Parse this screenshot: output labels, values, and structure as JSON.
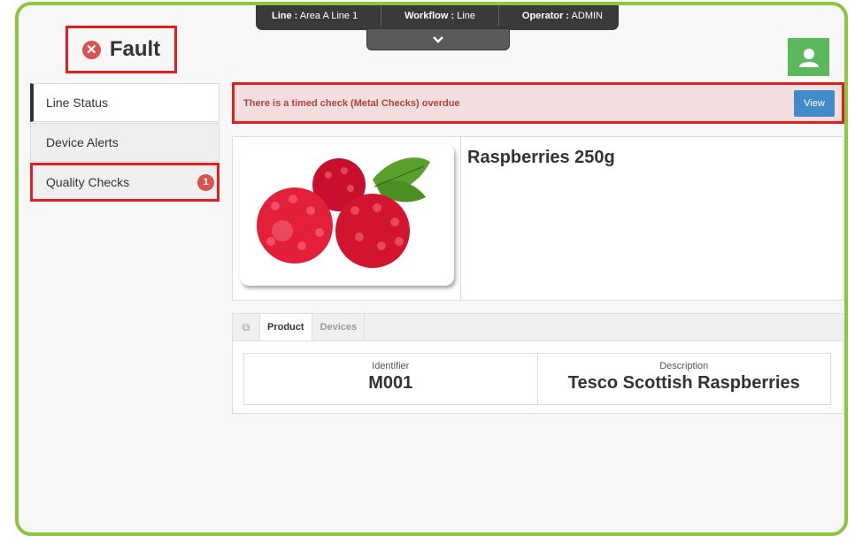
{
  "status": {
    "label": "Fault",
    "icon": "times-circle-icon",
    "color": "#d9534f"
  },
  "infobar": {
    "line_label": "Line :",
    "line_value": "Area A Line 1",
    "workflow_label": "Workflow :",
    "workflow_value": "Line",
    "operator_label": "Operator :",
    "operator_value": "ADMIN"
  },
  "sidebar": {
    "items": [
      {
        "label": "Line Status",
        "active": true
      },
      {
        "label": "Device Alerts"
      },
      {
        "label": "Quality Checks",
        "badge": "1"
      }
    ]
  },
  "alert": {
    "message": "There is a timed check (Metal Checks) overdue",
    "button": "View"
  },
  "product": {
    "name": "Raspberries 250g",
    "tabs": [
      "Product",
      "Devices"
    ],
    "identifier_label": "Identifier",
    "identifier": "M001",
    "description_label": "Description",
    "description": "Tesco Scottish Raspberries"
  },
  "colors": {
    "frame": "#8cc63f",
    "alert_bg": "#f2dede",
    "accent": "#428bca",
    "user": "#5cb85c"
  }
}
